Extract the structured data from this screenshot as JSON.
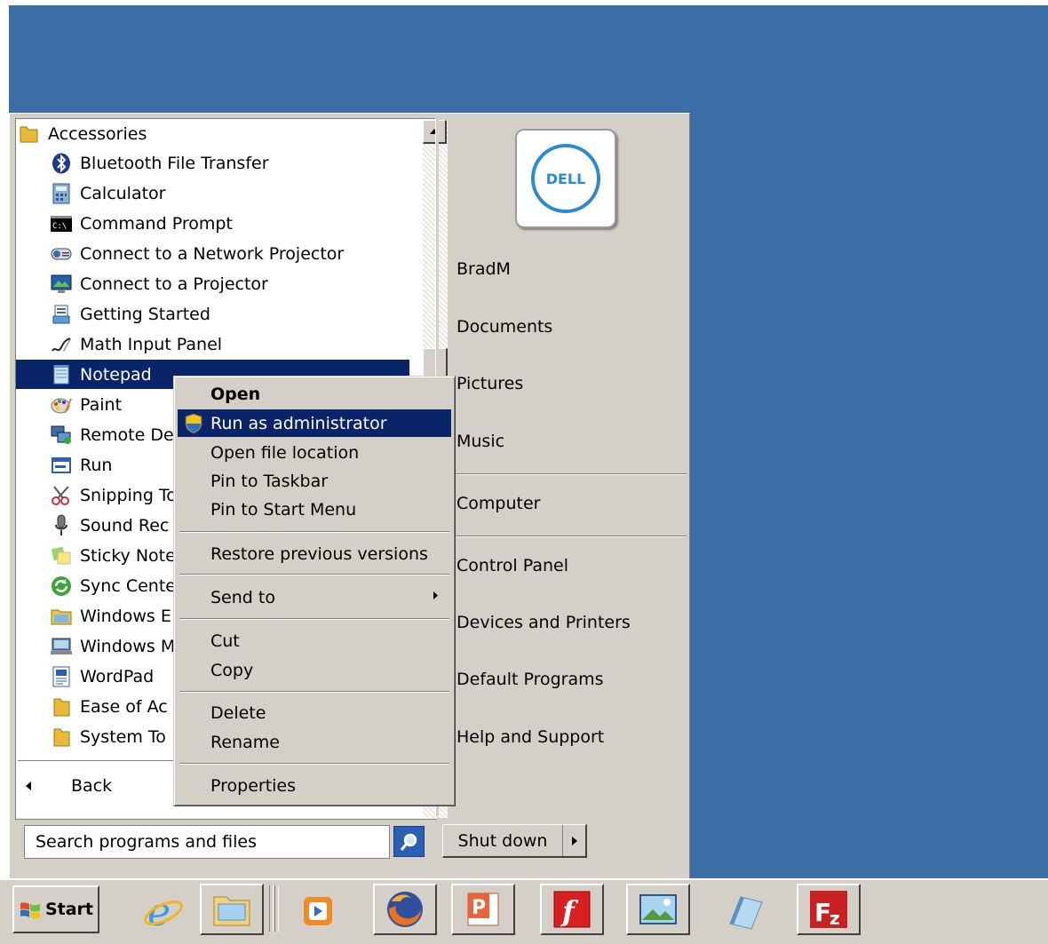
{
  "programs": {
    "folder_label": "Accessories",
    "items": [
      {
        "label": "Bluetooth File Transfer",
        "icon": "bluetooth-icon"
      },
      {
        "label": "Calculator",
        "icon": "calculator-icon"
      },
      {
        "label": "Command Prompt",
        "icon": "command-prompt-icon"
      },
      {
        "label": "Connect to a Network Projector",
        "icon": "network-projector-icon"
      },
      {
        "label": "Connect to a Projector",
        "icon": "projector-icon"
      },
      {
        "label": "Getting Started",
        "icon": "getting-started-icon"
      },
      {
        "label": "Math Input Panel",
        "icon": "math-input-icon"
      },
      {
        "label": "Notepad",
        "icon": "notepad-icon"
      },
      {
        "label": "Paint",
        "icon": "paint-icon"
      },
      {
        "label": "Remote De",
        "icon": "remote-desktop-icon"
      },
      {
        "label": "Run",
        "icon": "run-icon"
      },
      {
        "label": "Snipping To",
        "icon": "snipping-tool-icon"
      },
      {
        "label": "Sound Rec",
        "icon": "sound-recorder-icon"
      },
      {
        "label": "Sticky Note",
        "icon": "sticky-notes-icon"
      },
      {
        "label": "Sync Cente",
        "icon": "sync-center-icon"
      },
      {
        "label": "Windows E",
        "icon": "windows-explorer-icon"
      },
      {
        "label": "Windows M",
        "icon": "windows-mobility-icon"
      },
      {
        "label": "WordPad",
        "icon": "wordpad-icon"
      },
      {
        "label": "Ease of Ac",
        "icon": "folder-icon"
      },
      {
        "label": "System To",
        "icon": "folder-icon"
      }
    ],
    "back_label": "Back"
  },
  "search": {
    "placeholder": "Search programs and files"
  },
  "right_pane": {
    "items": [
      "BradM",
      "Documents",
      "Pictures",
      "Music",
      "Computer",
      "Control Panel",
      "Devices and Printers",
      "Default Programs",
      "Help and Support"
    ],
    "logo_text": "DELL"
  },
  "shutdown": {
    "label": "Shut down"
  },
  "context_menu": {
    "items": [
      "Open",
      "Run as administrator",
      "Open file location",
      "Pin to Taskbar",
      "Pin to Start Menu",
      "Restore previous versions",
      "Send to",
      "Cut",
      "Copy",
      "Delete",
      "Rename",
      "Properties"
    ]
  },
  "taskbar": {
    "start_label": "Start",
    "icons": [
      "internet-explorer-icon",
      "windows-explorer-icon",
      "media-player-icon",
      "firefox-icon",
      "powerpoint-icon",
      "flash-icon",
      "photo-viewer-icon",
      "notepad-icon",
      "filezilla-icon"
    ]
  },
  "colors": {
    "desktop": "#3a6ea5",
    "selection": "#0a246a",
    "menu_face": "#d4d0c8"
  }
}
